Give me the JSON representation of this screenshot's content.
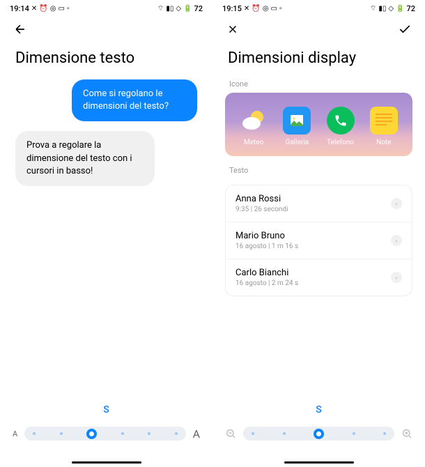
{
  "left": {
    "time": "19:14",
    "title": "Dimensione testo",
    "bubble_blue": "Come si regolano le dimensioni del testo?",
    "bubble_gray": "Prova a regolare la dimensione del testo con i cursori in basso!",
    "slider_label": "S",
    "slider_small": "A",
    "slider_big": "A"
  },
  "right": {
    "time": "19:15",
    "title": "Dimensioni display",
    "section_icons": "Icone",
    "section_text": "Testo",
    "apps": [
      {
        "label": "Meteo"
      },
      {
        "label": "Galleria"
      },
      {
        "label": "Telefono"
      },
      {
        "label": "Note"
      }
    ],
    "contacts": [
      {
        "name": "Anna Rossi",
        "sub": "9:35 | 26 secondi"
      },
      {
        "name": "Mario Bruno",
        "sub": "16 agosto | 1 m 16 s"
      },
      {
        "name": "Carlo Bianchi",
        "sub": "16 agosto | 2 m 24 s"
      }
    ],
    "slider_label": "S"
  },
  "status": {
    "battery": "72"
  }
}
